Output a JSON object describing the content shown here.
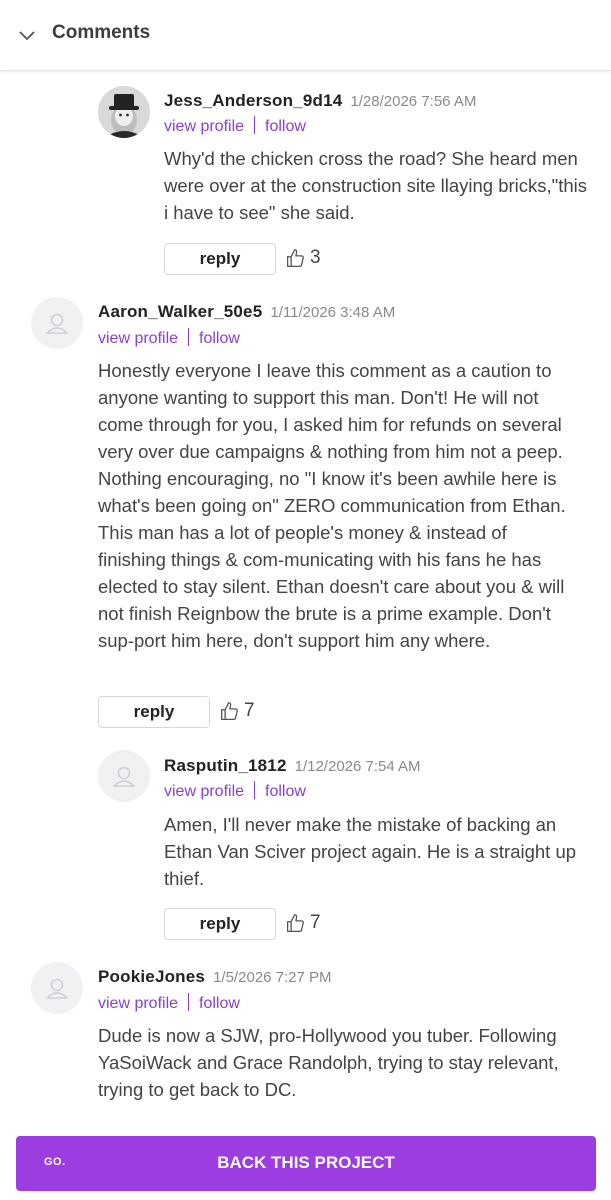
{
  "header": {
    "title": "Comments",
    "icon": "chevron-down-icon"
  },
  "comments": [
    {
      "username": "Jess_Anderson_9d14",
      "date": "1/28/2026 7:56 AM",
      "view_profile": "view profile",
      "follow": "follow",
      "text": "Why'd the chicken cross the road? She heard men were over at the construction site llaying bricks,\"this i have to see\" she said.",
      "reply": "reply",
      "likes": "3",
      "avatar": "photo-avatar"
    },
    {
      "username": "Aaron_Walker_50e5",
      "date": "1/11/2026 3:48 AM",
      "view_profile": "view profile",
      "follow": "follow",
      "text": "Honestly everyone I leave this comment as a caution to anyone wanting to support this man. Don't! He will not come through for you, I asked him for refunds on several very over due campaigns & nothing from him not a peep. Nothing encouraging, no \"I know it's been awhile here is what's been going on\" ZERO communication from Ethan. This man has a lot of people's money & instead of finishing things & com-municating with his fans he has elected to stay silent. Ethan doesn't care about you & will not finish Reignbow the brute is a prime example. Don't sup-port him here, don't support him any where.",
      "reply": "reply",
      "likes": "7",
      "avatar": "default-user-avatar"
    },
    {
      "username": "Rasputin_1812",
      "date": "1/12/2026 7:54 AM",
      "view_profile": "view profile",
      "follow": "follow",
      "text": "Amen, I'll never make the mistake of backing an Ethan Van Sciver project again. He is a straight up thief.",
      "reply": "reply",
      "likes": "7",
      "avatar": "default-user-avatar"
    },
    {
      "username": "PookieJones",
      "date": "1/5/2026 7:27 PM",
      "view_profile": "view profile",
      "follow": "follow",
      "text": "Dude is now a SJW, pro-Hollywood you tuber. Following YaSoiWack and Grace Randolph, trying to stay relevant, trying to get back to DC.",
      "avatar": "default-user-avatar"
    }
  ],
  "footer": {
    "logo": "GO.",
    "button_label": "BACK THIS PROJECT",
    "accent": "#9b3de0"
  },
  "colors": {
    "link": "#8b3fd0",
    "text": "#444444",
    "date": "#8a8a8a"
  }
}
